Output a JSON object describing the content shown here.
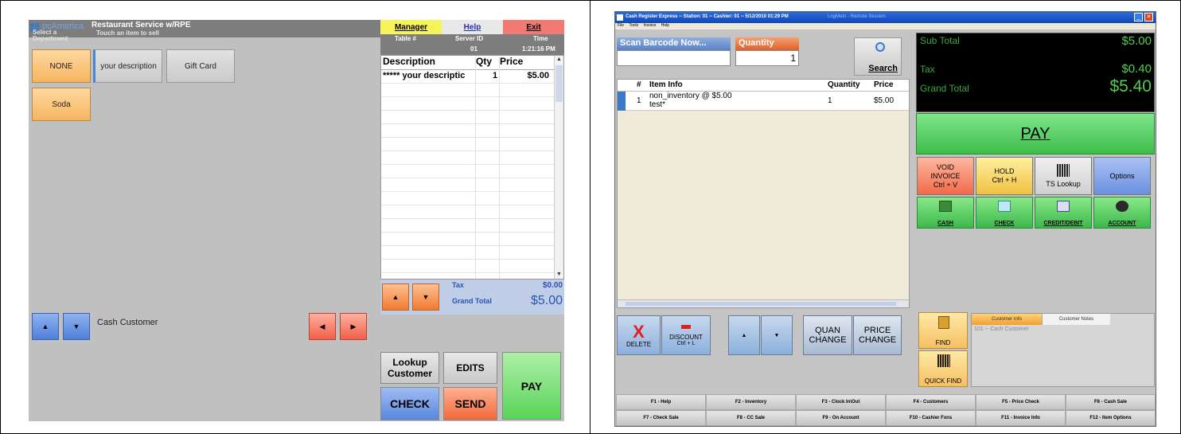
{
  "left": {
    "brand": "pcAmerica",
    "app_title": "Restaurant Service w/RPE",
    "hint_department": "Select a Department",
    "hint_touch": "Touch an item to sell",
    "departments": [
      "NONE",
      "Soda"
    ],
    "items": [
      "your description",
      "Gift Card"
    ],
    "top_buttons": {
      "manager": "Manager",
      "help": "Help",
      "exit": "Exit"
    },
    "info_header": {
      "table_label": "Table #",
      "server_label": "Server ID",
      "server_value": "01",
      "time_label": "Time",
      "time_value": "1:21:16 PM"
    },
    "ticket": {
      "headers": [
        "Description",
        "Qty",
        "Price"
      ],
      "rows": [
        {
          "description": "***** your descriptic",
          "qty": "1",
          "price": "$5.00"
        }
      ]
    },
    "totals": {
      "tax_label": "Tax",
      "tax_value": "$0.00",
      "grand_total_label": "Grand Total",
      "grand_total_value": "$5.00"
    },
    "customer": "Cash Customer",
    "buttons": {
      "lookup": "Lookup Customer",
      "edits": "EDITS",
      "pay": "PAY",
      "check": "CHECK",
      "send": "SEND"
    },
    "arrow_up": "▲",
    "arrow_down": "▼",
    "arrow_left": "◀",
    "arrow_right": "▶",
    "colors": {
      "dept": "#f5b560",
      "manager": "#f7f35a",
      "exit": "#f17a72",
      "total_text": "#2a55b5",
      "pay": "#5ad45a"
    }
  },
  "right": {
    "title": "Cash Register Express -- Station: 01 -- Cashier: 01 -- 5/12/2010 01:29 PM",
    "title_extra": "LogMeIn - Remote Session",
    "menu": [
      "File",
      "Tools",
      "Invoice",
      "Help"
    ],
    "scan_label": "Scan Barcode Now...",
    "quantity_label": "Quantity",
    "quantity_value": "1",
    "search_label": "Search",
    "grid": {
      "headers": [
        "#",
        "Item Info",
        "Quantity",
        "Price"
      ],
      "rows": [
        {
          "num": "1",
          "info_line1": "non_inventory @ $5.00",
          "info_line2": "test*",
          "quantity": "1",
          "price": "$5.00"
        }
      ]
    },
    "summary": {
      "sub_total_label": "Sub Total",
      "sub_total_value": "$5.00",
      "tax_label": "Tax",
      "tax_value": "$0.40",
      "grand_total_label": "Grand Total",
      "grand_total_value": "$5.40"
    },
    "pay_label": "PAY",
    "actions": {
      "void_line1": "VOID",
      "void_line2": "INVOICE",
      "void_line3": "Ctrl + V",
      "hold_line1": "HOLD",
      "hold_line2": "Ctrl + H",
      "tslookup": "TS Lookup",
      "options": "Options"
    },
    "pay_types": [
      "CASH",
      "CHECK",
      "CREDIT/DEBIT",
      "ACCOUNT"
    ],
    "tools": {
      "delete": "DELETE",
      "discount_line1": "DISCOUNT",
      "discount_line2": "Ctrl + L",
      "quan_line1": "QUAN",
      "quan_line2": "CHANGE",
      "price_line1": "PRICE",
      "price_line2": "CHANGE"
    },
    "find_label": "FIND",
    "quickfind_label": "QUICK FIND",
    "customer_tabs": [
      "Customer Info",
      "Customer Notes"
    ],
    "customer_text": "101 -- Cash Customer",
    "fkeys": [
      "F1 - Help",
      "F2 - Inventory",
      "F3 - Clock In\\Out",
      "F4 - Customers",
      "F5 - Price Check",
      "F6 - Cash Sale",
      "F7 - Check Sale",
      "F8 - CC Sale",
      "F9 - On Account",
      "F10 - Cashier Fxns",
      "F11 - Invoice Info",
      "F12 - Item Options"
    ],
    "delete_glyph": "X",
    "arrow_up": "▲",
    "arrow_down": "▼",
    "win_min": "_",
    "win_close": "✕",
    "colors": {
      "summary_bg": "#000000",
      "summary_text": "#4fcf4f",
      "pay": "#3dbd4a",
      "void": "#f06a4a",
      "hold": "#f0c040",
      "options": "#6a90e0"
    }
  }
}
